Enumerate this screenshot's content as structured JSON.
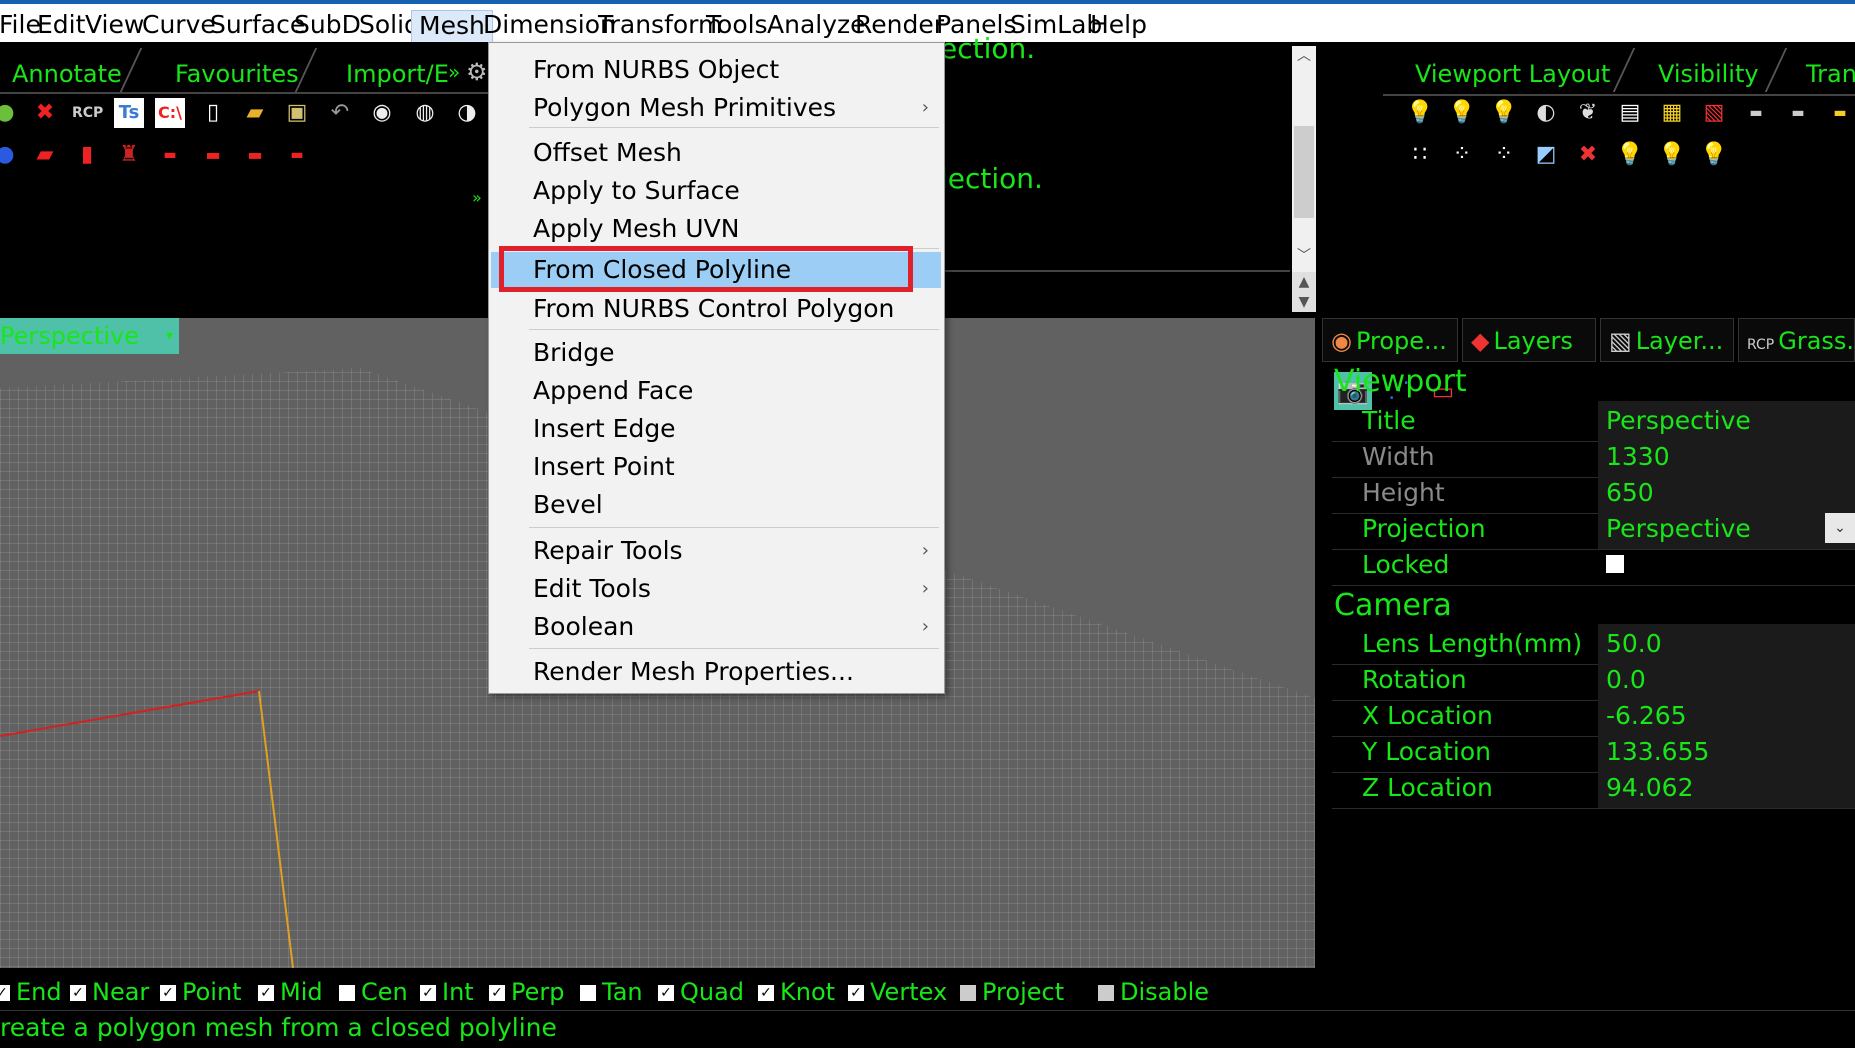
{
  "menubar": {
    "items": [
      "File",
      "Edit",
      "View",
      "Curve",
      "Surface",
      "SubD",
      "Solid",
      "Mesh",
      "Dimension",
      "Transform",
      "Tools",
      "Analyze",
      "Render",
      "Panels",
      "SimLab",
      "Help"
    ]
  },
  "toolbar_tabs": [
    "Annotate",
    "Favourites",
    "Import/E"
  ],
  "command_history": [
    "ection.",
    "lection."
  ],
  "right_tabs": [
    "Viewport Layout",
    "Visibility",
    "Tran"
  ],
  "mesh_menu": {
    "items": [
      {
        "label": "From NURBS Object",
        "submenu": false
      },
      {
        "label": "Polygon Mesh Primitives",
        "submenu": true
      },
      {
        "label": "Offset Mesh",
        "submenu": false
      },
      {
        "label": "Apply to Surface",
        "submenu": false
      },
      {
        "label": "Apply Mesh UVN",
        "submenu": false
      },
      {
        "label": "From Closed Polyline",
        "submenu": false,
        "highlighted": true
      },
      {
        "label": "From NURBS Control Polygon",
        "submenu": false
      },
      {
        "label": "Bridge",
        "submenu": false
      },
      {
        "label": "Append Face",
        "submenu": false
      },
      {
        "label": "Insert Edge",
        "submenu": false
      },
      {
        "label": "Insert Point",
        "submenu": false
      },
      {
        "label": "Bevel",
        "submenu": false
      },
      {
        "label": "Repair Tools",
        "submenu": true
      },
      {
        "label": "Edit Tools",
        "submenu": true
      },
      {
        "label": "Boolean",
        "submenu": true
      },
      {
        "label": "Render Mesh Properties...",
        "submenu": false
      }
    ],
    "submenu_arrow": "›"
  },
  "viewport": {
    "label": "Perspective"
  },
  "panel": {
    "tabs": [
      "Prope...",
      "Layers",
      "Layer...",
      "Grass..."
    ],
    "grass_prefix": "RCP",
    "viewport_section": "Viewport",
    "viewport_props": [
      {
        "label": "Title",
        "value": "Perspective"
      },
      {
        "label": "Width",
        "value": "1330"
      },
      {
        "label": "Height",
        "value": "650"
      },
      {
        "label": "Projection",
        "value": "Perspective"
      },
      {
        "label": "Locked",
        "value": ""
      }
    ],
    "camera_section": "Camera",
    "camera_props": [
      {
        "label": "Lens Length(mm)",
        "value": "50.0"
      },
      {
        "label": "Rotation",
        "value": "0.0"
      },
      {
        "label": "X Location",
        "value": "-6.265"
      },
      {
        "label": "Y Location",
        "value": "133.655"
      },
      {
        "label": "Z Location",
        "value": "94.062"
      }
    ]
  },
  "osnap": [
    {
      "label": "End",
      "checked": true
    },
    {
      "label": "Near",
      "checked": true
    },
    {
      "label": "Point",
      "checked": true
    },
    {
      "label": "Mid",
      "checked": true
    },
    {
      "label": "Cen",
      "checked": false
    },
    {
      "label": "Int",
      "checked": true
    },
    {
      "label": "Perp",
      "checked": true
    },
    {
      "label": "Tan",
      "checked": false
    },
    {
      "label": "Quad",
      "checked": true
    },
    {
      "label": "Knot",
      "checked": true
    },
    {
      "label": "Vertex",
      "checked": true
    },
    {
      "label": "Project",
      "checked": false
    },
    {
      "label": "Disable",
      "checked": false
    }
  ],
  "status": {
    "text": "reate a polygon mesh from a closed polyline"
  },
  "icons": {
    "left_row1": [
      "globe-icon",
      "grasshopper-icon",
      "rcp-icon",
      "ts-icon",
      "cmd-icon",
      "new-file-icon",
      "open-folder-icon",
      "save-icon",
      "undo-icon",
      "sphere-icon",
      "sphere-grid-icon",
      "sphere-shade-icon"
    ],
    "left_row2": [
      "blue-sphere-icon",
      "car-red-icon",
      "bus-icon",
      "figure-icon",
      "car-small-icon",
      "car-icon",
      "car-icon",
      "car-icon"
    ],
    "right_row1": [
      "bulb-icon",
      "bulb-on-icon",
      "bulb-on-icon",
      "bulb-split-icon",
      "bulb-pair-icon",
      "doc-icon",
      "doc-lock-icon",
      "doc-tab-icon",
      "rect-icon",
      "rect-icon",
      "rect-yellow-icon"
    ],
    "right_row2": [
      "points-icon",
      "grid-dots-icon",
      "grid-dots-icon",
      "cube-icon",
      "x-cube-icon",
      "bulb-icon",
      "bulb-icon",
      "bulb-icon"
    ]
  },
  "colors": {
    "accent_green": "#19e619",
    "highlight": "#9ccef5",
    "callout_red": "#e0202a",
    "title_bar": "#1560b0"
  }
}
